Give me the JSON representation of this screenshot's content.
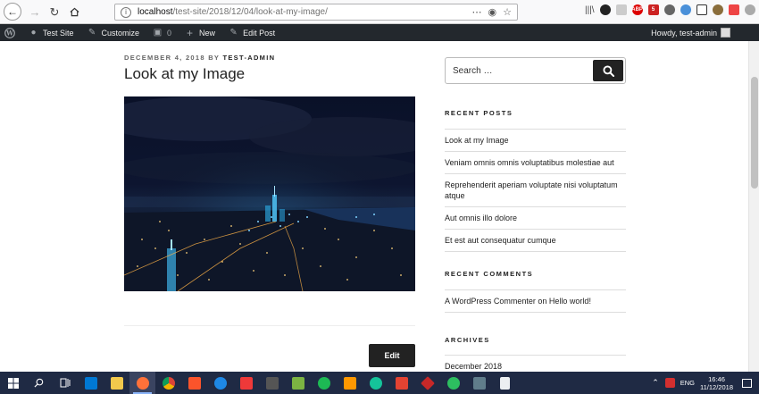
{
  "browser": {
    "url_host": "localhost",
    "url_path": "/test-site/2018/12/04/look-at-my-image/"
  },
  "adminbar": {
    "site_name": "Test Site",
    "customize": "Customize",
    "comments_count": "0",
    "new": "New",
    "edit_post": "Edit Post",
    "howdy": "Howdy, test-admin"
  },
  "post": {
    "date": "December 4, 2018",
    "by": "by",
    "author": "test-admin",
    "title": "Look at my Image",
    "edit_label": "Edit"
  },
  "sidebar": {
    "search_placeholder": "Search …",
    "recent_posts_title": "Recent Posts",
    "recent_posts": [
      "Look at my Image",
      "Veniam omnis omnis voluptatibus molestiae aut",
      "Reprehenderit aperiam voluptate nisi voluptatum atque",
      "Aut omnis illo dolore",
      "Et est aut consequatur cumque"
    ],
    "recent_comments_title": "Recent Comments",
    "recent_comment": {
      "author": "A WordPress Commenter",
      "on": "on",
      "post": "Hello world!"
    },
    "archives_title": "Archives",
    "archives": [
      "December 2018"
    ]
  },
  "taskbar": {
    "language": "ENG",
    "time": "16:46",
    "date": "11/12/2018"
  },
  "colors": {
    "adminbar_bg": "#23282d",
    "taskbar_bg": "#1f2a44",
    "button_dark": "#222222"
  }
}
